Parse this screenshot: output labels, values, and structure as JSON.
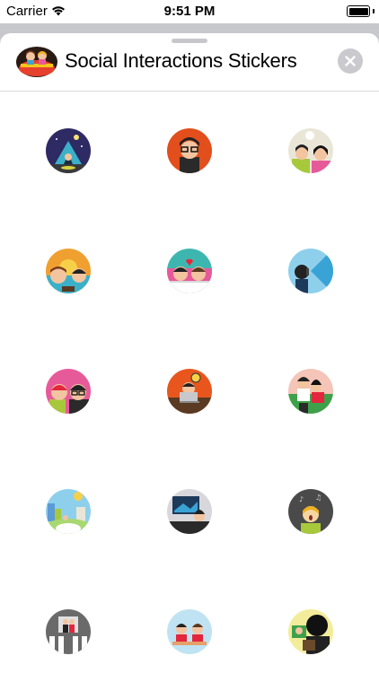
{
  "status_bar": {
    "carrier": "Carrier",
    "time": "9:51 PM"
  },
  "sheet": {
    "title": "Social Interactions Stickers",
    "close_icon": "close-icon"
  },
  "stickers": [
    {
      "name": "tent-camping-sticker"
    },
    {
      "name": "glasses-man-sticker"
    },
    {
      "name": "couple-selfie-sticker"
    },
    {
      "name": "beach-friends-sticker"
    },
    {
      "name": "heart-hug-sticker"
    },
    {
      "name": "phone-caller-sticker"
    },
    {
      "name": "two-friends-sticker"
    },
    {
      "name": "office-laptop-sticker"
    },
    {
      "name": "dancing-couple-sticker"
    },
    {
      "name": "city-park-sticker"
    },
    {
      "name": "tv-watching-sticker"
    },
    {
      "name": "music-singer-sticker"
    },
    {
      "name": "crosswalk-sticker"
    },
    {
      "name": "dinner-table-sticker"
    },
    {
      "name": "video-call-sticker"
    }
  ]
}
